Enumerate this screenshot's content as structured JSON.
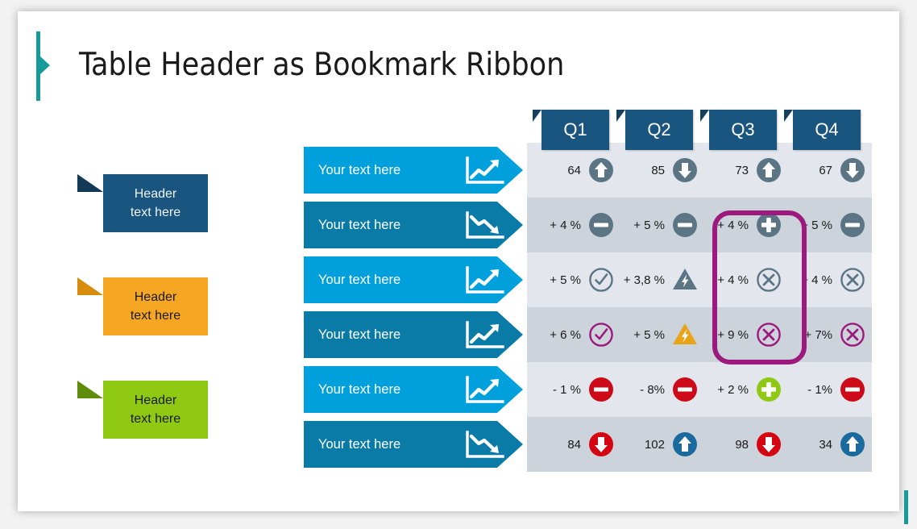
{
  "slide": {
    "title": "Table Header as Bookmark Ribbon",
    "accent_color": "#179a9a"
  },
  "bookmarks": [
    {
      "line1": "Header",
      "line2": "text here",
      "color": "#1a5580",
      "fold_color": "#13405f",
      "text_color": "#eef4f8"
    },
    {
      "line1": "Header",
      "line2": "text here",
      "color": "#f5a623",
      "fold_color": "#d88c0d",
      "text_color": "#1a1a1a"
    },
    {
      "line1": "Header",
      "line2": "text here",
      "color": "#8fc913",
      "fold_color": "#5f8c0c",
      "text_color": "#1a1a1a"
    }
  ],
  "table": {
    "column_headers": [
      "Q1",
      "Q2",
      "Q3",
      "Q4"
    ],
    "header_color": "#1a5580",
    "row_bg_light": "#e3e7ed",
    "row_bg_dark": "#ccd3db",
    "label_color_light": "#00a0dd",
    "label_color_dark": "#0a7ba6",
    "rows": [
      {
        "label": "Your text here",
        "trend": "chart-up-icon",
        "band": "light",
        "cells": [
          {
            "value": "64",
            "icon": "arrow-up-circle-icon",
            "icon_color": "#5c7585"
          },
          {
            "value": "85",
            "icon": "arrow-down-circle-icon",
            "icon_color": "#5c7585"
          },
          {
            "value": "73",
            "icon": "arrow-up-circle-icon",
            "icon_color": "#5c7585"
          },
          {
            "value": "67",
            "icon": "arrow-down-circle-icon",
            "icon_color": "#5c7585"
          }
        ]
      },
      {
        "label": "Your text here",
        "trend": "chart-down-icon",
        "band": "dark",
        "cells": [
          {
            "value": "+ 4 %",
            "icon": "minus-circle-icon",
            "icon_color": "#5c7585"
          },
          {
            "value": "+ 5 %",
            "icon": "minus-circle-icon",
            "icon_color": "#5c7585"
          },
          {
            "value": "+ 4 %",
            "icon": "plus-circle-icon",
            "icon_color": "#5c7585"
          },
          {
            "value": "+ 5 %",
            "icon": "minus-circle-icon",
            "icon_color": "#5c7585"
          }
        ]
      },
      {
        "label": "Your text here",
        "trend": "chart-up-icon",
        "band": "light",
        "cells": [
          {
            "value": "+ 5 %",
            "icon": "check-circle-outline-icon",
            "icon_color": "#5c7585"
          },
          {
            "value": "+ 3,8 %",
            "icon": "warning-bolt-triangle-icon",
            "icon_color": "#5c7585"
          },
          {
            "value": "+ 4 %",
            "icon": "x-circle-outline-icon",
            "icon_color": "#5c7585"
          },
          {
            "value": "+ 4 %",
            "icon": "x-circle-outline-icon",
            "icon_color": "#5c7585"
          }
        ]
      },
      {
        "label": "Your text here",
        "trend": "chart-up-icon",
        "band": "dark",
        "cells": [
          {
            "value": "+ 6 %",
            "icon": "check-circle-outline-icon",
            "icon_color": "#9c1a7e"
          },
          {
            "value": "+ 5 %",
            "icon": "warning-bolt-triangle-icon",
            "icon_color": "#e8a317"
          },
          {
            "value": "+ 9 %",
            "icon": "x-circle-outline-icon",
            "icon_color": "#9c1a7e"
          },
          {
            "value": "+ 7%",
            "icon": "x-circle-outline-icon",
            "icon_color": "#9c1a7e"
          }
        ]
      },
      {
        "label": "Your text here",
        "trend": "chart-up-icon",
        "band": "light",
        "cells": [
          {
            "value": "- 1 %",
            "icon": "minus-circle-icon",
            "icon_color": "#cc0a18"
          },
          {
            "value": "- 8%",
            "icon": "minus-circle-icon",
            "icon_color": "#cc0a18"
          },
          {
            "value": "+ 2 %",
            "icon": "plus-circle-icon",
            "icon_color": "#8fc913"
          },
          {
            "value": "- 1%",
            "icon": "minus-circle-icon",
            "icon_color": "#cc0a18"
          }
        ]
      },
      {
        "label": "Your text here",
        "trend": "chart-down-icon",
        "band": "dark",
        "cells": [
          {
            "value": "84",
            "icon": "arrow-down-circle-icon",
            "icon_color": "#d40511"
          },
          {
            "value": "102",
            "icon": "arrow-up-circle-icon",
            "icon_color": "#1a6a9e"
          },
          {
            "value": "98",
            "icon": "arrow-down-circle-icon",
            "icon_color": "#d40511"
          },
          {
            "value": "34",
            "icon": "arrow-up-circle-icon",
            "icon_color": "#1a6a9e"
          }
        ]
      }
    ]
  },
  "highlight": {
    "name": "pen-annotation-rounded-rect",
    "color": "#9c1a7e",
    "covers_column": "Q3",
    "covers_rows": [
      2,
      3,
      4
    ]
  }
}
